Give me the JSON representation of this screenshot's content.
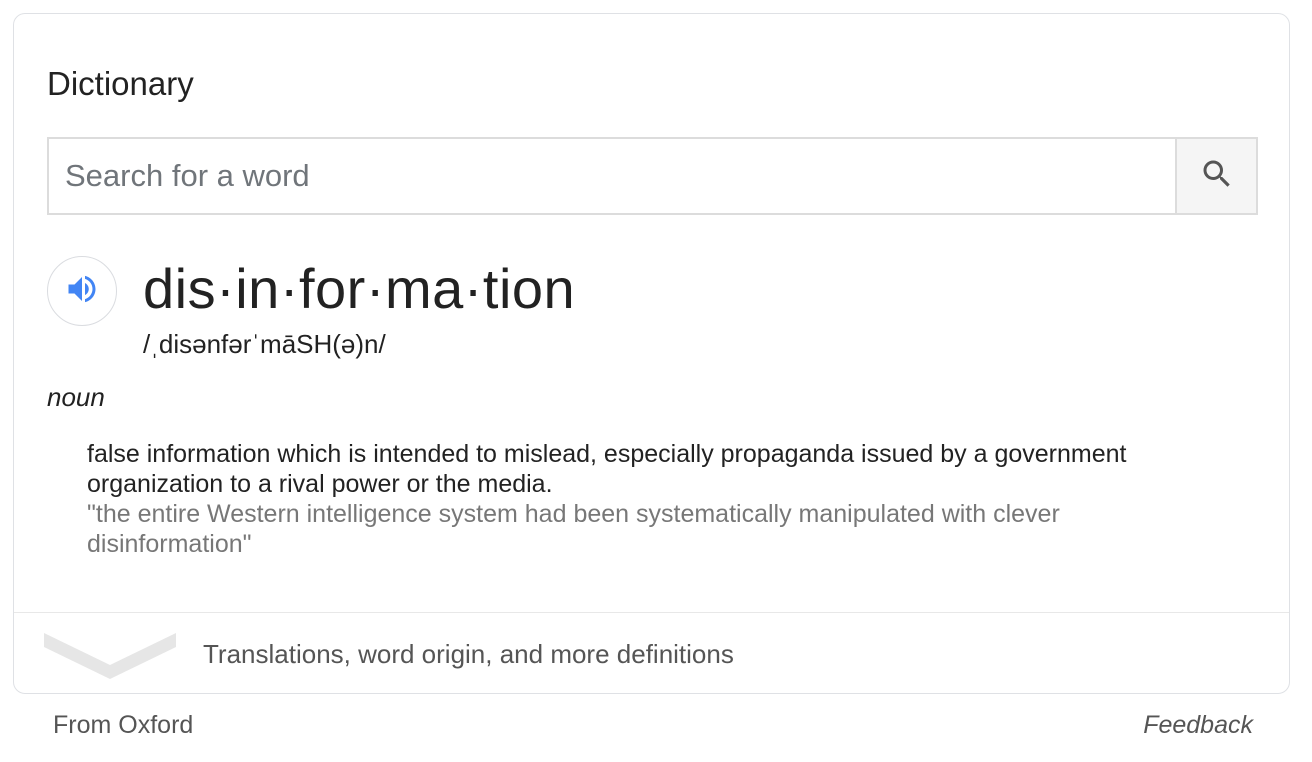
{
  "card": {
    "title": "Dictionary"
  },
  "search": {
    "placeholder": "Search for a word",
    "value": "",
    "button_icon": "search-icon"
  },
  "entry": {
    "speaker_icon": "speaker-icon",
    "headword": "dis·in·for·ma·tion",
    "phonetic": "/ˌdisənfərˈmāSH(ə)n/",
    "part_of_speech": "noun",
    "definition": "false information which is intended to mislead, especially propaganda issued by a government organization to a rival power or the media.",
    "example": "\"the entire Western intelligence system had been systematically manipulated with clever disinformation\""
  },
  "more": {
    "label": "Translations, word origin, and more definitions",
    "icon": "chevron-down-icon"
  },
  "footer": {
    "source": "From Oxford",
    "feedback": "Feedback"
  },
  "colors": {
    "speaker_blue": "#4285f4",
    "text": "#222222",
    "example_gray": "#777777",
    "border": "#dfe1e5"
  }
}
